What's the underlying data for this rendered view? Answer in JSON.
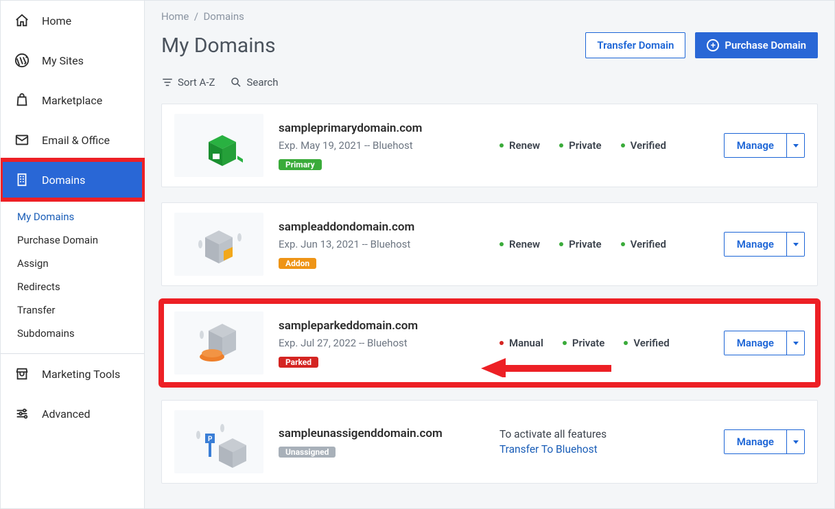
{
  "breadcrumb": {
    "home": "Home",
    "current": "Domains"
  },
  "page_title": "My Domains",
  "header_buttons": {
    "transfer": "Transfer Domain",
    "purchase": "Purchase Domain"
  },
  "toolbar": {
    "sort": "Sort A-Z",
    "search": "Search"
  },
  "sidebar": {
    "items": [
      {
        "label": "Home"
      },
      {
        "label": "My Sites"
      },
      {
        "label": "Marketplace"
      },
      {
        "label": "Email & Office"
      },
      {
        "label": "Domains"
      },
      {
        "label": "Marketing Tools"
      },
      {
        "label": "Advanced"
      }
    ],
    "subitems": [
      {
        "label": "My Domains"
      },
      {
        "label": "Purchase Domain"
      },
      {
        "label": "Assign"
      },
      {
        "label": "Redirects"
      },
      {
        "label": "Transfer"
      },
      {
        "label": "Subdomains"
      }
    ]
  },
  "manage_label": "Manage",
  "domains": [
    {
      "name": "sampleprimarydomain.com",
      "exp": "Exp. May 19, 2021 -- Bluehost",
      "badge": "Primary",
      "badge_class": "badge-green",
      "statuses": [
        {
          "label": "Renew",
          "dot": "green"
        },
        {
          "label": "Private",
          "dot": "green"
        },
        {
          "label": "Verified",
          "dot": "green"
        }
      ]
    },
    {
      "name": "sampleaddondomain.com",
      "exp": "Exp. Jun 13, 2021 -- Bluehost",
      "badge": "Addon",
      "badge_class": "badge-orange",
      "statuses": [
        {
          "label": "Renew",
          "dot": "green"
        },
        {
          "label": "Private",
          "dot": "green"
        },
        {
          "label": "Verified",
          "dot": "green"
        }
      ]
    },
    {
      "name": "sampleparkeddomain.com",
      "exp": "Exp. Jul 27, 2022 -- Bluehost",
      "badge": "Parked",
      "badge_class": "badge-red",
      "statuses": [
        {
          "label": "Manual",
          "dot": "red"
        },
        {
          "label": "Private",
          "dot": "green"
        },
        {
          "label": "Verified",
          "dot": "green"
        }
      ]
    },
    {
      "name": "sampleunassigenddomain.com",
      "exp": "",
      "badge": "Unassigned",
      "badge_class": "badge-grey",
      "activate_text": "To activate all features",
      "activate_link": "Transfer To Bluehost"
    }
  ]
}
